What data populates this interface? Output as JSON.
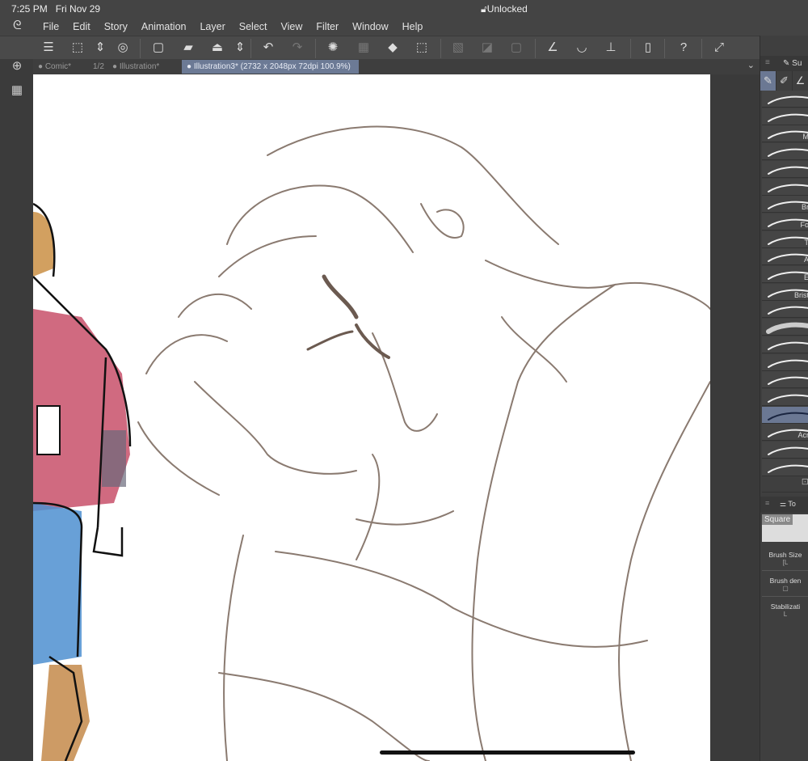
{
  "status": {
    "time": "7:25 PM",
    "date": "Fri Nov 29",
    "lock": "Unlocked"
  },
  "menu": [
    "File",
    "Edit",
    "Story",
    "Animation",
    "Layer",
    "Select",
    "View",
    "Filter",
    "Window",
    "Help"
  ],
  "tabs": [
    {
      "label": "Comic*",
      "page": "1/2"
    },
    {
      "label": "Illustration*"
    },
    {
      "label": "Illustration3* (2732 x 2048px 72dpi 100.9%)",
      "active": true
    }
  ],
  "right_panel": {
    "subtool_header": "Su",
    "brushes": [
      "",
      "",
      "M",
      "",
      "",
      "",
      "Br",
      "Fo",
      "T",
      "A",
      "E",
      "Brist",
      "",
      "",
      "",
      "",
      "",
      "",
      "",
      "Acr",
      "",
      ""
    ],
    "selected_brush_index": 18,
    "tool_property_header": "To",
    "preview_label": "Square",
    "props": [
      "Brush Size",
      "Brush den",
      "Stabilizati"
    ]
  },
  "colors": {
    "accent": "#6b7893",
    "line": "#8a7a70"
  }
}
